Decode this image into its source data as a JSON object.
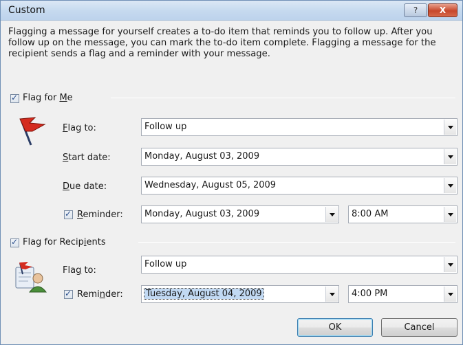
{
  "window": {
    "title": "Custom",
    "help_label": "?",
    "close_label": "X"
  },
  "description": "Flagging a message for yourself creates a to-do item that reminds you to follow up. After you follow up on the message, you can mark the to-do item complete. Flagging a message for the recipient sends a flag and a reminder with your message.",
  "flag_for_me": {
    "checked": true,
    "label_pre": "Flag for ",
    "label_key": "M",
    "label_post": "e",
    "flag_to_label_key": "F",
    "flag_to_label_rest": "lag to:",
    "flag_to_value": "Follow up",
    "start_date_label_key": "S",
    "start_date_label_rest": "tart date:",
    "start_date_value": "Monday, August 03, 2009",
    "due_date_label_key": "D",
    "due_date_label_rest": "ue date:",
    "due_date_value": "Wednesday, August 05, 2009",
    "reminder_checked": true,
    "reminder_label_key": "R",
    "reminder_label_rest": "eminder:",
    "reminder_date": "Monday, August 03, 2009",
    "reminder_time": "8:00 AM"
  },
  "flag_for_recipients": {
    "checked": true,
    "label_pre": "Flag for Recip",
    "label_key": "i",
    "label_post": "ents",
    "flag_to_label_pre": "Fla",
    "flag_to_label_key": "g",
    "flag_to_label_post": " to:",
    "flag_to_value": "Follow up",
    "reminder_checked": true,
    "reminder_label_pre": "Remi",
    "reminder_label_key": "n",
    "reminder_label_post": "der:",
    "reminder_date": "Tuesday, August 04, 2009",
    "reminder_time": "4:00 PM"
  },
  "buttons": {
    "ok": "OK",
    "cancel": "Cancel"
  },
  "colors": {
    "flag_red": "#d42b1f",
    "title_bar": "#c5d9ef",
    "selection": "#c1d9f3"
  }
}
